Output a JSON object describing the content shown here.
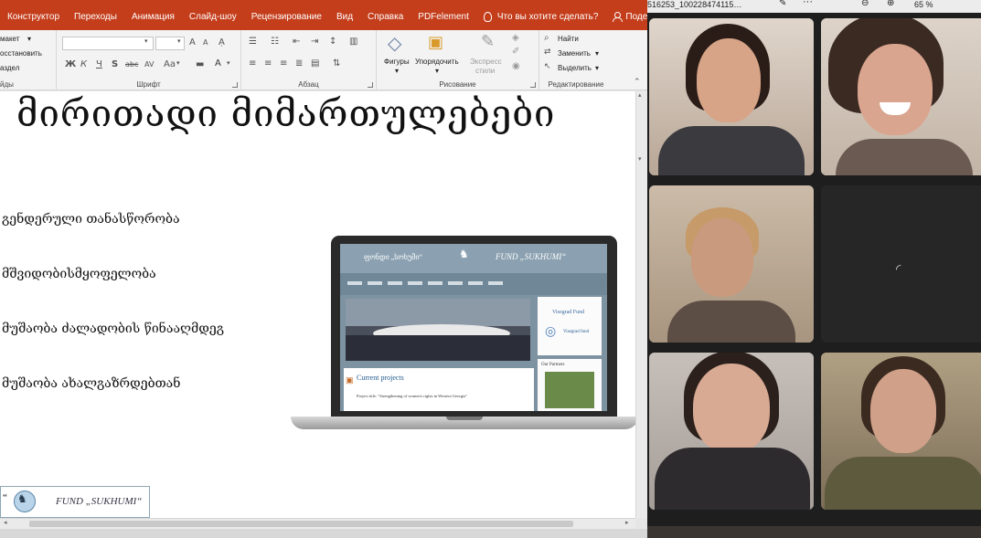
{
  "ribbon_tabs": [
    "Конструктор",
    "Переходы",
    "Анимация",
    "Слайд-шоу",
    "Рецензирование",
    "Вид",
    "Справка",
    "PDFelement"
  ],
  "tell_me": "Что вы хотите сделать?",
  "share": "Поделиться",
  "ribbon": {
    "layout": "макет",
    "reset": "осстановить",
    "section": "аздел",
    "slides_group": "йды",
    "font_group": "Шрифт",
    "paragraph_group": "Абзац",
    "drawing_group": "Рисование",
    "editing_group": "Редактирование",
    "shapes": "Фигуры",
    "arrange": "Упорядочить",
    "quick_styles_1": "Экспресс",
    "quick_styles_2": "стили",
    "find": "Найти",
    "replace": "Заменить",
    "select": "Выделить",
    "font_size_up": "A",
    "font_size_down": "A",
    "bold": "Ж",
    "italic": "К",
    "underline": "Ч",
    "shadow": "S",
    "strike": "abc",
    "spacing": "AV",
    "case": "Aa",
    "font_color": "A"
  },
  "slide": {
    "title": "მირითადი მიმართულებები",
    "bullets": [
      "გენდერული თანასწორობა",
      "მშვიდობისმყოფელობა",
      "მუშაობა ძალადობის წინააღმდეგ",
      "მუშაობა ახალგაზრდებთან"
    ],
    "logo_text": "FUND „SUKHUMI“",
    "logo_quote": "“"
  },
  "laptop_site": {
    "header_left": "ფონდი „სოხუმი“",
    "header_right": "FUND „SUKHUMI“",
    "current_projects": "Current projects",
    "project_title": "Project title: \"Strengthening of women's rights in Western Georgia\"",
    "visegrad": "Visegrad Fund",
    "visegrad_small": "Visegrad fund",
    "partners": "Our Partners"
  },
  "zoom": {
    "meeting_id": "516253_100228474115…",
    "more": "···",
    "zoom_percent": "65 %"
  },
  "colors": {
    "ppt_accent": "#c43e1c",
    "ribbon_bg": "#f3f3f3",
    "site_header": "#8ba1b1"
  }
}
